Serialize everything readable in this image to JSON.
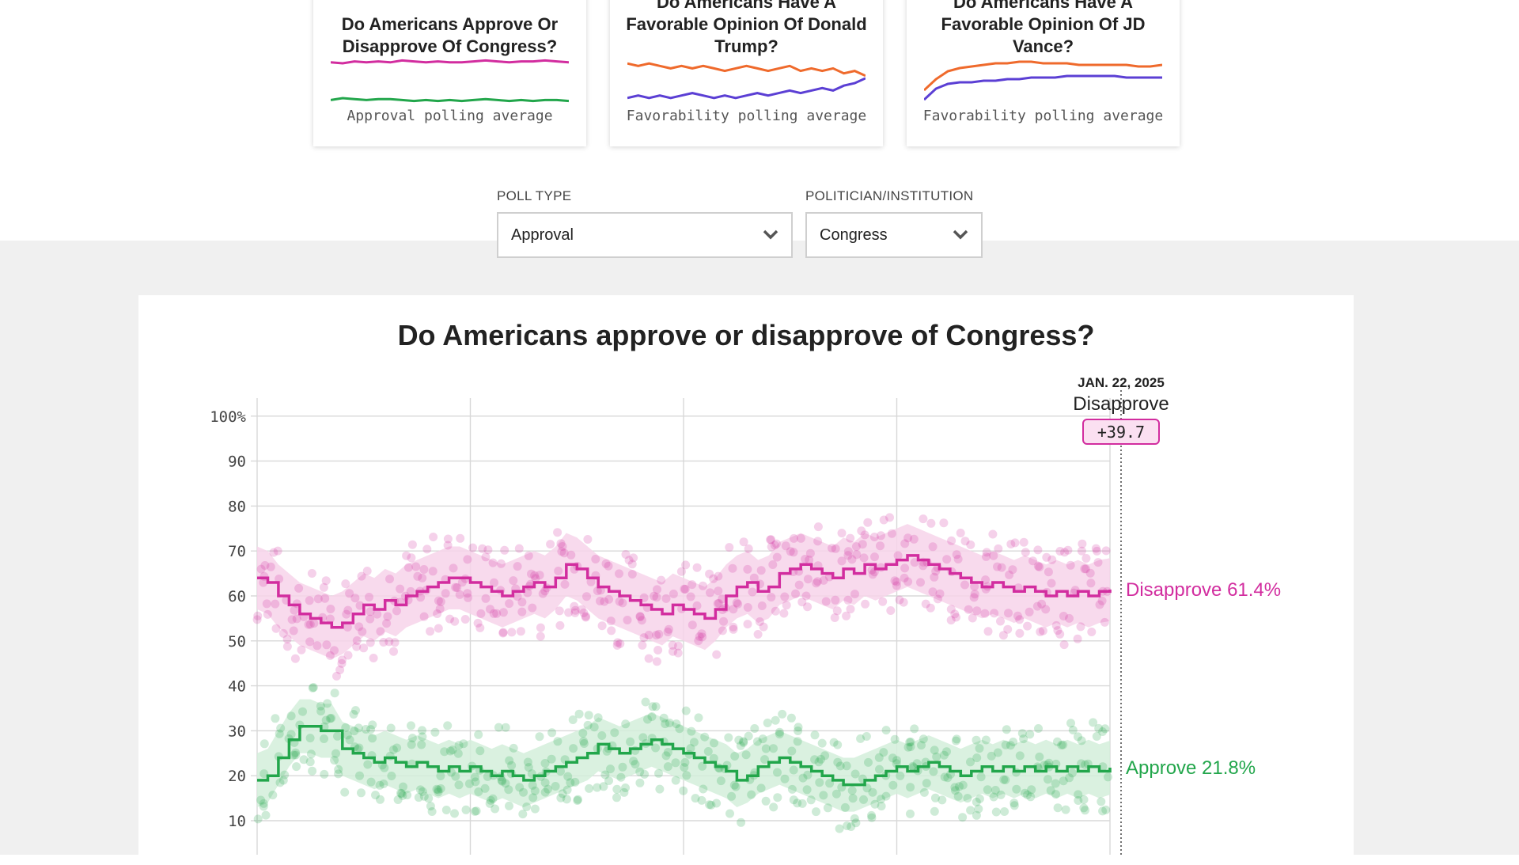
{
  "cards": [
    {
      "title": "Do Americans Approve Or Disapprove Of Congress?",
      "caption": "Approval polling average",
      "lines": [
        {
          "color": "#d22d9f",
          "values": [
            62,
            61,
            63,
            62,
            63,
            62,
            64,
            63,
            62,
            63,
            62,
            62,
            63,
            64,
            63,
            62,
            63,
            63,
            64,
            63,
            62
          ]
        },
        {
          "color": "#22a64b",
          "values": [
            22,
            24,
            23,
            22,
            23,
            23,
            22,
            21,
            22,
            21,
            22,
            21,
            22,
            23,
            22,
            21,
            22,
            21,
            22,
            22,
            21
          ]
        }
      ]
    },
    {
      "title": "Do Americans Have A Favorable Opinion Of Donald Trump?",
      "caption": "Favorability polling average",
      "lines": [
        {
          "color": "#ef6a2c",
          "values": [
            55,
            54,
            55,
            54,
            53,
            54,
            53,
            54,
            53,
            52,
            53,
            54,
            53,
            52,
            53,
            54,
            52,
            53,
            52,
            53,
            51,
            52,
            50
          ]
        },
        {
          "color": "#5b3fd4",
          "values": [
            41,
            42,
            41,
            42,
            41,
            42,
            43,
            42,
            41,
            42,
            41,
            42,
            43,
            42,
            43,
            44,
            43,
            44,
            45,
            44,
            46,
            47,
            49
          ]
        }
      ]
    },
    {
      "title": "Do Americans Have A Favorable Opinion Of JD Vance?",
      "caption": "Favorability polling average",
      "lines": [
        {
          "color": "#ef6a2c",
          "values": [
            28,
            35,
            40,
            42,
            43,
            44,
            45,
            45,
            46,
            46,
            45,
            45,
            45,
            44,
            44,
            44,
            44,
            44,
            43,
            43,
            44
          ]
        },
        {
          "color": "#5b3fd4",
          "values": [
            22,
            29,
            32,
            33,
            33,
            34,
            34,
            35,
            35,
            36,
            36,
            36,
            37,
            37,
            37,
            37,
            37,
            36,
            36,
            36,
            36
          ]
        }
      ]
    }
  ],
  "controls": {
    "poll_type_label": "POLL TYPE",
    "poll_type_value": "Approval",
    "politician_label": "POLITICIAN/INSTITUTION",
    "politician_value": "Congress"
  },
  "colors": {
    "disapprove": "#d22d9f",
    "approve": "#22a64b",
    "disapprove_band": "#f7d4ea",
    "approve_band": "#d4eedb",
    "badge_bg": "#fbe0f1"
  },
  "tooltip": {
    "date": "JAN. 22, 2025",
    "leader": "Disapprove",
    "margin": "+39.7"
  },
  "chart_data": {
    "type": "line",
    "title": "Do Americans approve or disapprove of Congress?",
    "xlabel": "",
    "ylabel": "",
    "ylim": [
      0,
      100
    ],
    "yticks": [
      "10",
      "20",
      "30",
      "40",
      "50",
      "60",
      "70",
      "80",
      "90",
      "100%"
    ],
    "grid": true,
    "x": [
      0,
      1,
      2,
      3,
      4,
      5,
      6,
      7,
      8,
      9,
      10,
      11,
      12,
      13,
      14,
      15,
      16,
      17,
      18,
      19,
      20,
      21,
      22,
      23,
      24,
      25,
      26,
      27,
      28,
      29,
      30,
      31,
      32,
      33,
      34,
      35,
      36,
      37,
      38,
      39,
      40,
      41,
      42,
      43,
      44,
      45,
      46,
      47,
      48,
      49,
      50,
      51,
      52,
      53,
      54,
      55,
      56,
      57,
      58,
      59,
      60,
      61,
      62,
      63,
      64,
      65,
      66,
      67,
      68,
      69,
      70,
      71,
      72,
      73,
      74,
      75,
      76,
      77,
      78,
      79,
      80
    ],
    "series": [
      {
        "name": "Disapprove",
        "end_label": "Disapprove 61.4%",
        "values": [
          64,
          63,
          60,
          58,
          56,
          55,
          54,
          53,
          54,
          56,
          58,
          57,
          59,
          58,
          60,
          61,
          62,
          63,
          64,
          64,
          63,
          62,
          61,
          60,
          61,
          62,
          63,
          62,
          64,
          67,
          66,
          64,
          62,
          61,
          60,
          59,
          58,
          57,
          56,
          58,
          57,
          56,
          55,
          57,
          60,
          62,
          63,
          61,
          62,
          65,
          66,
          67,
          66,
          65,
          64,
          66,
          65,
          67,
          66,
          67,
          68,
          69,
          68,
          67,
          66,
          65,
          64,
          63,
          62,
          63,
          62,
          61,
          62,
          61,
          60,
          61,
          60,
          61,
          60,
          61,
          61.4
        ]
      },
      {
        "name": "Approve",
        "end_label": "Approve 21.8%",
        "values": [
          19,
          20,
          24,
          28,
          31,
          31,
          30,
          30,
          26,
          25,
          24,
          23,
          24,
          23,
          22,
          23,
          22,
          21,
          22,
          21,
          22,
          21,
          20,
          21,
          20,
          19,
          20,
          21,
          22,
          23,
          24,
          25,
          27,
          26,
          25,
          26,
          27,
          28,
          27,
          26,
          25,
          24,
          23,
          22,
          21,
          19,
          20,
          22,
          23,
          24,
          23,
          22,
          21,
          20,
          19,
          18,
          18,
          19,
          20,
          21,
          22,
          21,
          22,
          23,
          22,
          21,
          20,
          21,
          22,
          21,
          22,
          21,
          22,
          21,
          22,
          21,
          22,
          21,
          22,
          21,
          21.8
        ]
      }
    ]
  }
}
